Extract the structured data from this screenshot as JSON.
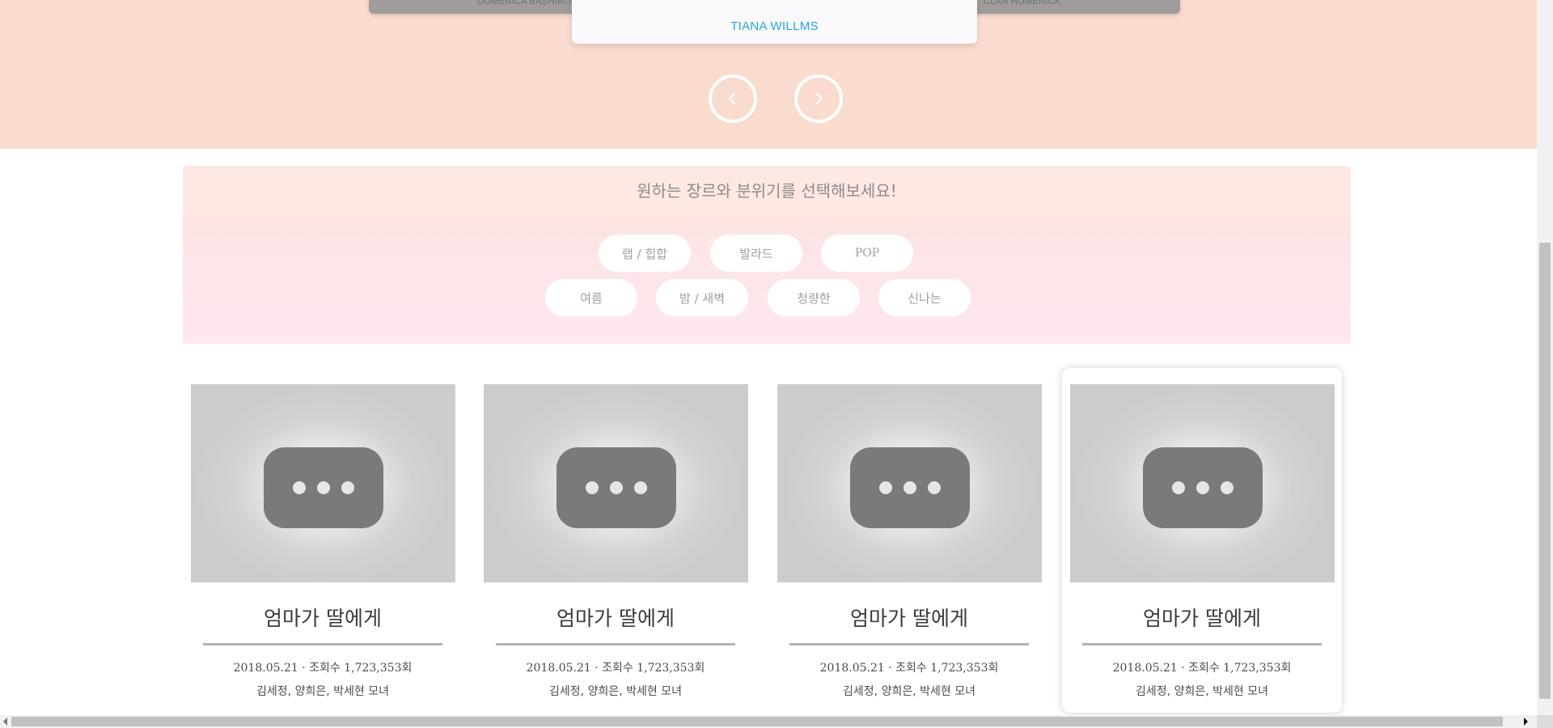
{
  "carousel": {
    "left_card_label": "DOMENICA BASHIRO",
    "center_card_label": "TIANA WILLMS",
    "right_card_label": "CLAN HOMENICK",
    "prev_icon": "chevron-left-icon",
    "next_icon": "chevron-right-icon"
  },
  "filter": {
    "heading": "원하는 장르와 분위기를 선택해보세요!",
    "chips": [
      {
        "label": "랩 / 힙합"
      },
      {
        "label": "발라드"
      },
      {
        "label": "POP"
      },
      {
        "label": "여름"
      },
      {
        "label": "밤 / 새벽"
      },
      {
        "label": "청량한"
      },
      {
        "label": "신나는"
      }
    ]
  },
  "cards": [
    {
      "title": "엄마가 딸에게",
      "meta": "2018.05.21 · 조회수 1,723,353회",
      "artists": "김세정, 양희은, 박세현 모녀",
      "thumbnail_icon": "video-placeholder-icon"
    },
    {
      "title": "엄마가 딸에게",
      "meta": "2018.05.21 · 조회수 1,723,353회",
      "artists": "김세정, 양희은, 박세현 모녀",
      "thumbnail_icon": "video-placeholder-icon"
    },
    {
      "title": "엄마가 딸에게",
      "meta": "2018.05.21 · 조회수 1,723,353회",
      "artists": "김세정, 양희은, 박세현 모녀",
      "thumbnail_icon": "video-placeholder-icon"
    },
    {
      "title": "엄마가 딸에게",
      "meta": "2018.05.21 · 조회수 1,723,353회",
      "artists": "김세정, 양희은, 박세현 모녀",
      "thumbnail_icon": "video-placeholder-icon"
    }
  ],
  "colors": {
    "hero_background": "#fadbcf",
    "accent_name": "#2aa3dd",
    "filter_head": "#fde8e3",
    "chip_background": "#ffffff"
  }
}
